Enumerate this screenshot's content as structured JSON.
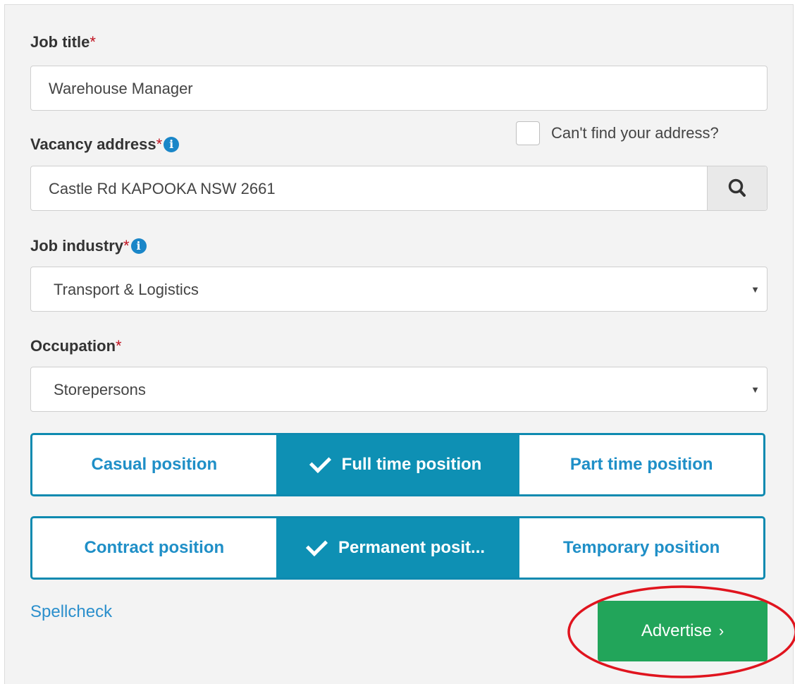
{
  "form": {
    "required_mark": "*",
    "job_title": {
      "label": "Job title",
      "value": "Warehouse Manager"
    },
    "vacancy_address": {
      "label": "Vacancy address",
      "value": "Castle Rd KAPOOKA NSW 2661",
      "cant_find_label": "Can't find your address?",
      "cant_find_checked": false,
      "info_glyph": "i",
      "search_icon": "search-icon"
    },
    "job_industry": {
      "label": "Job industry",
      "value": "Transport & Logistics",
      "info_glyph": "i",
      "caret": "▼"
    },
    "occupation": {
      "label": "Occupation",
      "value": "Storepersons",
      "caret": "▼"
    },
    "position_hours": {
      "options": [
        "Casual position",
        "Full time position",
        "Part time position"
      ],
      "selected": "Full time position"
    },
    "position_type": {
      "options": [
        "Contract position",
        "Permanent posit...",
        "Temporary position"
      ],
      "selected": "Permanent posit..."
    },
    "spellcheck_label": "Spellcheck",
    "advertise_label": "Advertise",
    "advertise_chevron": "›",
    "annotation_color": "#e0141e",
    "accent_color": "#0e90b4",
    "button_color": "#22a55a"
  }
}
